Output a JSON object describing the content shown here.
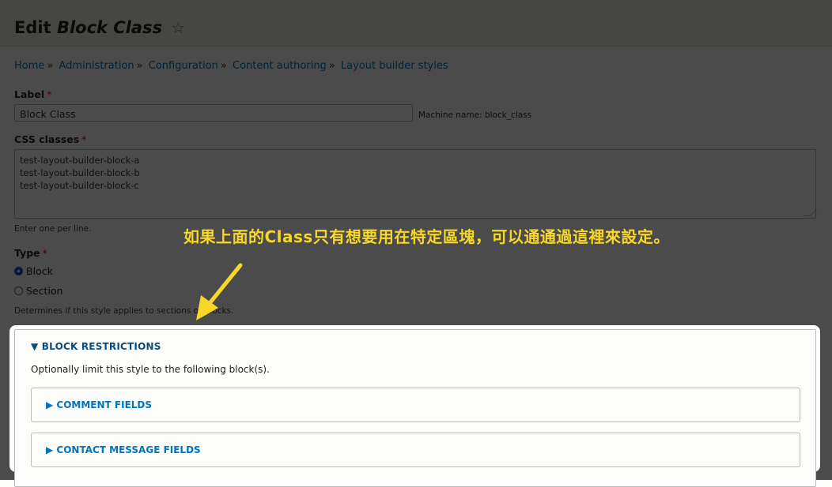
{
  "page": {
    "title_prefix": "Edit",
    "title_entity": "Block Class",
    "star_icon": "☆"
  },
  "breadcrumb": [
    "Home",
    "Administration",
    "Configuration",
    "Content authoring",
    "Layout builder styles"
  ],
  "breadcrumb_sep": "»",
  "form": {
    "label_field": {
      "label": "Label",
      "required": "*",
      "value": "Block Class",
      "machine_name": "Machine name: block_class"
    },
    "css_field": {
      "label": "CSS classes",
      "required": "*",
      "value": "test-layout-builder-block-a\ntest-layout-builder-block-b\ntest-layout-builder-block-c",
      "help": "Enter one per line."
    },
    "type_field": {
      "label": "Type",
      "required": "*",
      "options": [
        {
          "label": "Block",
          "checked": true
        },
        {
          "label": "Section",
          "checked": false
        }
      ],
      "help": "Determines if this style applies to sections or blocks."
    },
    "block_restrictions": {
      "summary": "▼ BLOCK RESTRICTIONS",
      "description": "Optionally limit this style to the following block(s).",
      "groups": [
        "▶ COMMENT FIELDS",
        "▶ CONTACT MESSAGE FIELDS"
      ]
    }
  },
  "annotation": {
    "text": "如果上面的Class只有想要用在特定區塊，可以通通過這裡來設定。",
    "color": "#f7d728"
  }
}
